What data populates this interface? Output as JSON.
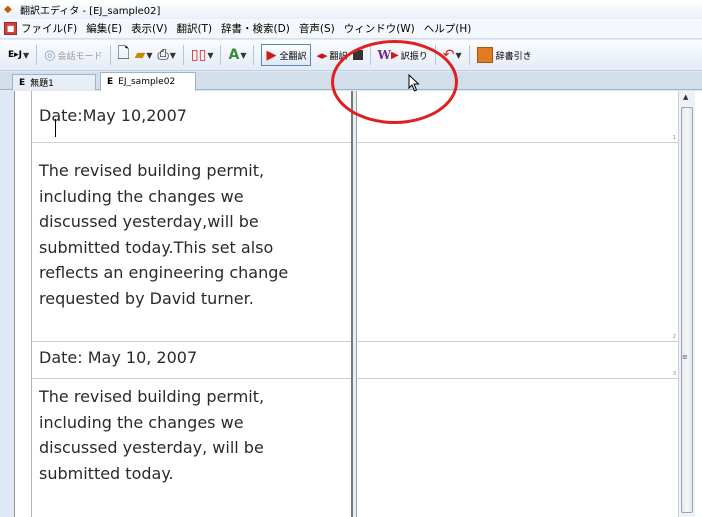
{
  "window": {
    "title": "翻訳エディタ - [EJ_sample02]",
    "app_icon": "translate-editor-icon"
  },
  "menubar": {
    "items": [
      "ファイル(F)",
      "編集(E)",
      "表示(V)",
      "翻訳(T)",
      "辞書・検索(D)",
      "音声(S)",
      "ウィンドウ(W)",
      "ヘルプ(H)"
    ]
  },
  "toolbar": {
    "direction_label": "E▸J",
    "conversation_mode_label": "会話モード",
    "translate_all_label": "全翻訳",
    "translate_label": "翻訳",
    "alternate_translation_label": "訳振り",
    "dictionary_lookup_label": "辞書引き"
  },
  "tabs": [
    {
      "prefix": "E",
      "label": "無題1"
    },
    {
      "prefix": "E",
      "label": "EJ_sample02"
    }
  ],
  "segments": [
    {
      "number": "1",
      "lines": [
        "Date:May 10,2007"
      ]
    },
    {
      "number": "2",
      "lines": [
        "The revised building permit,",
        "including the changes we",
        "discussed yesterday,will be",
        "submitted today.This set also",
        "reflects an engineering change",
        "requested by David turner."
      ]
    },
    {
      "number": "3",
      "lines": [
        "Date: May 10, 2007"
      ]
    },
    {
      "number": "4",
      "lines": [
        "The revised building permit,",
        "including the changes we",
        "discussed yesterday, will be",
        "submitted today."
      ]
    }
  ],
  "colors": {
    "highlight_ring": "#e02020",
    "play_icon": "#d01818"
  }
}
